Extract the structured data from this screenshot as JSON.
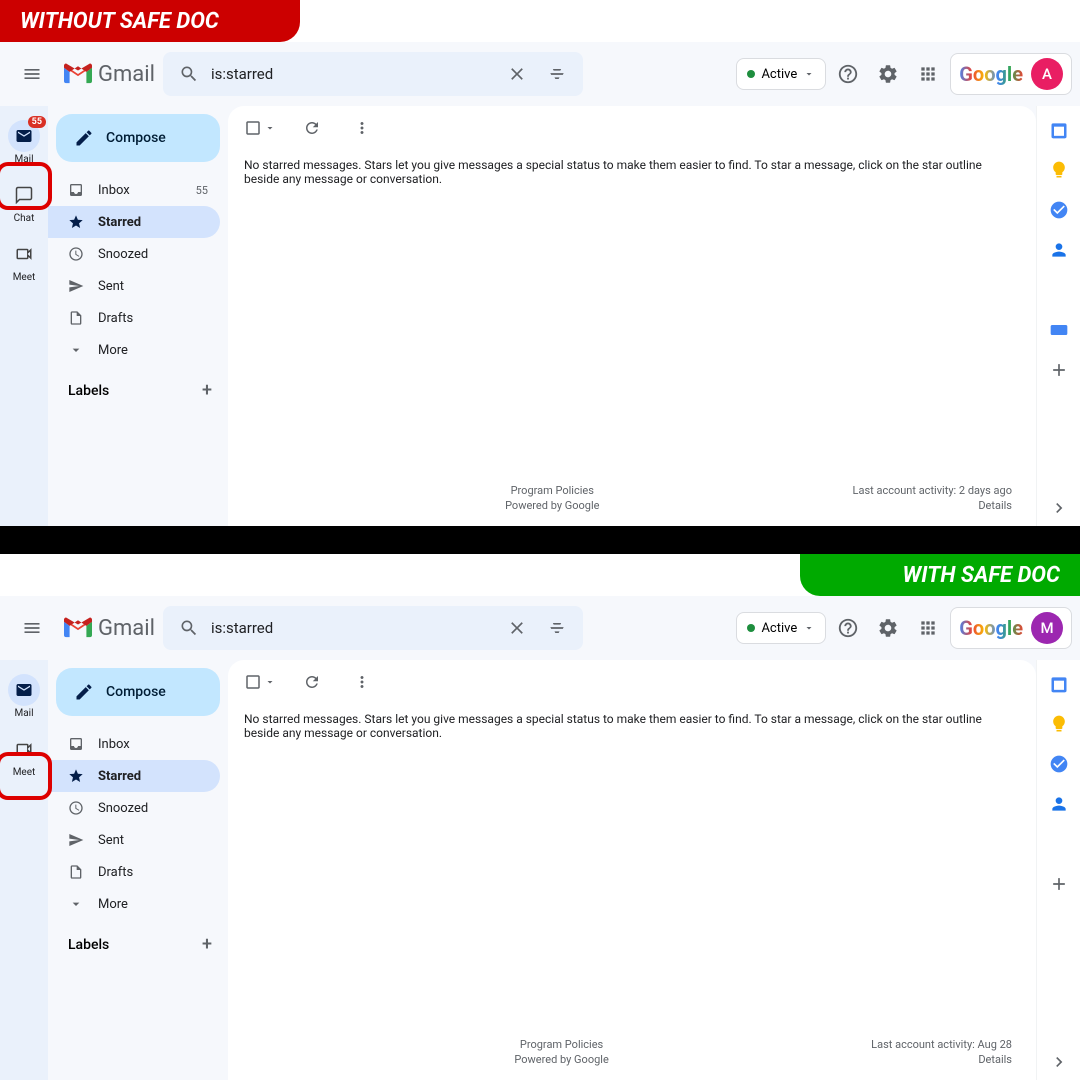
{
  "banners": {
    "without": "WITHOUT SAFE DOC",
    "with": "WITH SAFE DOC"
  },
  "top": {
    "brand": "Gmail",
    "search_value": "is:starred",
    "active_label": "Active",
    "google": "Google",
    "avatar": "A",
    "compose": "Compose",
    "nav": {
      "inbox": "Inbox",
      "inbox_count": "55",
      "starred": "Starred",
      "snoozed": "Snoozed",
      "sent": "Sent",
      "drafts": "Drafts",
      "more": "More"
    },
    "labels": "Labels",
    "rail": {
      "mail": "Mail",
      "mail_badge": "55",
      "chat": "Chat",
      "meet": "Meet"
    },
    "empty": "No starred messages. Stars let you give messages a special status to make them easier to find. To star a message, click on the star outline beside any message or conversation.",
    "footer": {
      "policies": "Program Policies",
      "powered": "Powered by Google",
      "activity": "Last account activity: 2 days ago",
      "details": "Details"
    }
  },
  "bottom": {
    "brand": "Gmail",
    "search_value": "is:starred",
    "active_label": "Active",
    "google": "Google",
    "avatar": "M",
    "compose": "Compose",
    "nav": {
      "inbox": "Inbox",
      "starred": "Starred",
      "snoozed": "Snoozed",
      "sent": "Sent",
      "drafts": "Drafts",
      "more": "More"
    },
    "labels": "Labels",
    "rail": {
      "mail": "Mail",
      "meet": "Meet"
    },
    "empty": "No starred messages. Stars let you give messages a special status to make them easier to find. To star a message, click on the star outline beside any message or conversation.",
    "footer": {
      "policies": "Program Policies",
      "powered": "Powered by Google",
      "activity": "Last account activity: Aug 28",
      "details": "Details"
    }
  }
}
